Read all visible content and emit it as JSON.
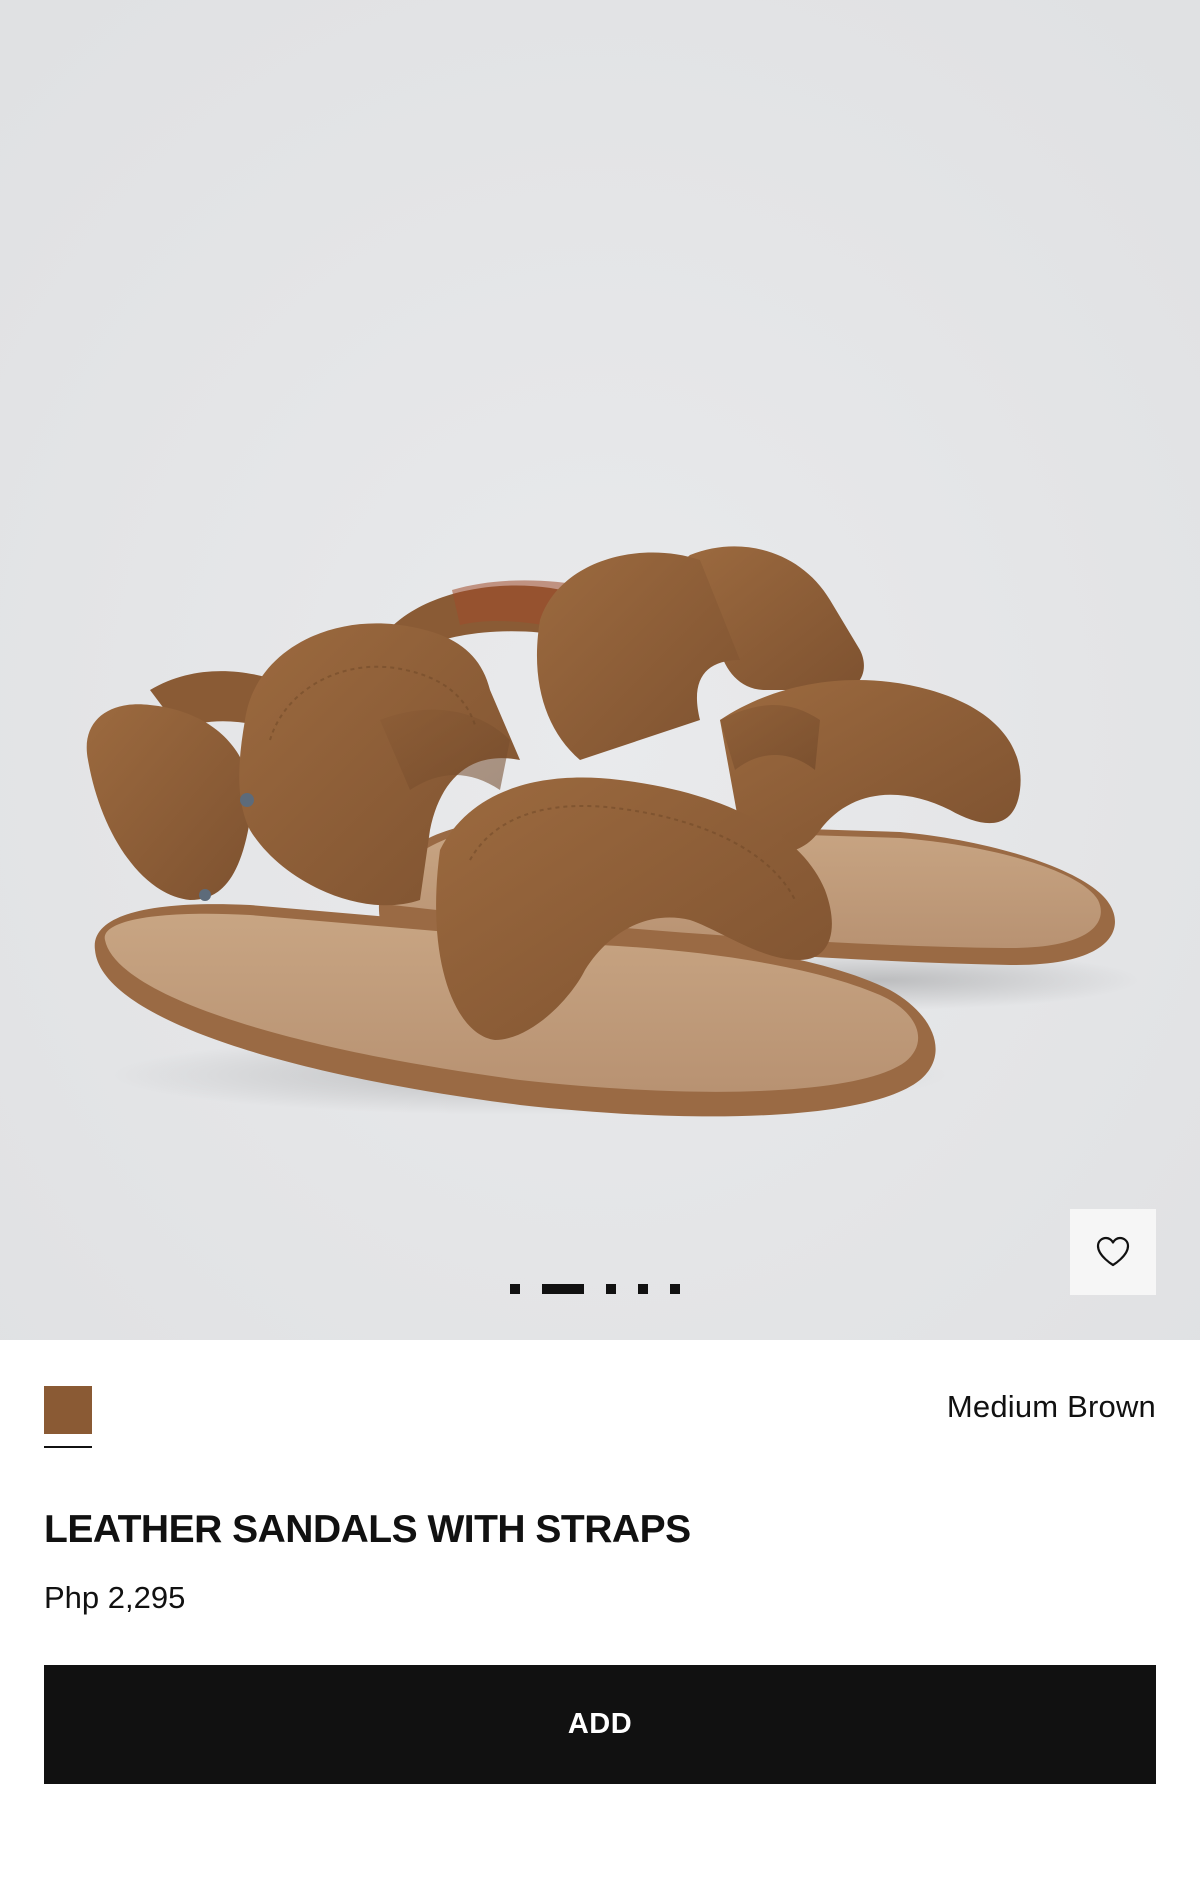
{
  "product": {
    "title": "LEATHER SANDALS WITH STRAPS",
    "price": "Php 2,295",
    "image_description_icon": "sandals-photo",
    "wishlist_icon": "heart-outline-icon"
  },
  "carousel": {
    "total_images": 5,
    "active_index": 1
  },
  "color": {
    "selected_name": "Medium Brown",
    "swatch_hex": "#8a5a34"
  },
  "actions": {
    "add_label": "ADD"
  },
  "colors": {
    "image_background": "#e4e5e7",
    "button_background": "#111111",
    "button_text": "#ffffff"
  }
}
